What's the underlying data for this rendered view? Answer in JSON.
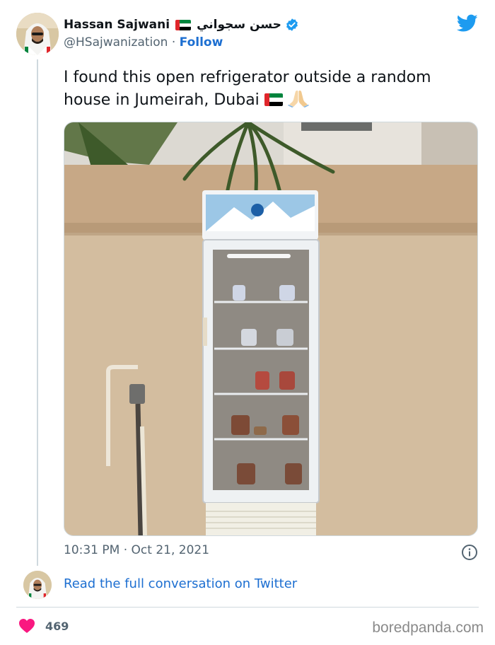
{
  "author": {
    "display_name": "Hassan Sajwani",
    "arabic_name": "حسن سجواني",
    "handle": "@HSajwanization",
    "separator": "·",
    "follow_label": "Follow",
    "verified_icon": "verified-badge-icon",
    "flag_icon": "uae-flag-icon",
    "avatar_icon": "profile-avatar"
  },
  "tweet": {
    "text": "I found this open refrigerator outside a random house in Jumeirah, Dubai",
    "emojis": [
      "uae-flag-icon",
      "folded-hands-icon"
    ],
    "photo_icon": "photo-refrigerator-outside-wall",
    "timestamp": "10:31 PM · Oct 21, 2021"
  },
  "footer": {
    "read_conversation_label": "Read the full conversation on Twitter",
    "like_count": "469",
    "like_icon": "heart-icon",
    "info_icon": "info-icon"
  },
  "branding": {
    "twitter_logo": "twitter-bird-icon",
    "watermark": "boredpanda.com"
  },
  "colors": {
    "twitter_blue": "#1d9bf0",
    "link_blue": "#1d6fd1",
    "heart_pink": "#f91880",
    "muted_text": "#536471"
  }
}
